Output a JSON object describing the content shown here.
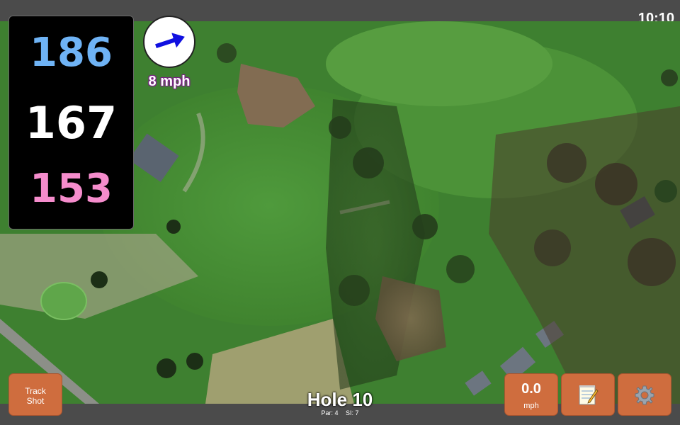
{
  "status_bar": {
    "clock": "10:10"
  },
  "distances": {
    "back": "186",
    "middle": "167",
    "front": "153",
    "colors": {
      "back": "#6fb3f5",
      "middle": "#ffffff",
      "front": "#f58ccc"
    }
  },
  "wind": {
    "speed_label": "8 mph",
    "direction_icon": "arrow-right-icon"
  },
  "buttons": {
    "track_shot": {
      "line1": "Track",
      "line2": "Shot"
    },
    "wind_readout": {
      "value": "0.0",
      "unit": "mph"
    },
    "notes": {
      "icon": "notepad-icon"
    },
    "settings": {
      "icon": "gear-icon"
    }
  },
  "hole": {
    "title": "Hole 10",
    "par": "Par: 4",
    "si": "SI: 7"
  },
  "colors": {
    "button": "#cf6d3e",
    "wind_arrow": "#1010e0",
    "wind_text_outline": "#7b1f86"
  }
}
